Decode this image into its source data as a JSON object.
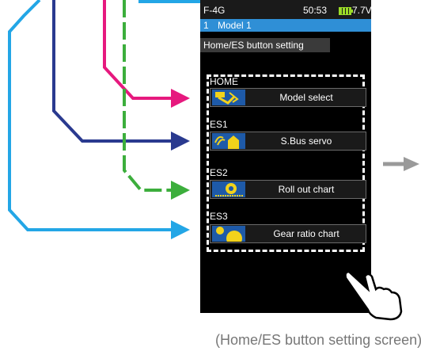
{
  "status_bar": {
    "model": "F-4G",
    "timer": "50:53",
    "voltage": "7.7V"
  },
  "model_row": {
    "number": "1",
    "name": "Model 1"
  },
  "screen_title": "Home/ES button setting",
  "buttons": [
    {
      "key": "HOME",
      "label": "Model select",
      "icon": "model-select-icon"
    },
    {
      "key": "ES1",
      "label": "S.Bus servo",
      "icon": "sbus-servo-icon"
    },
    {
      "key": "ES2",
      "label": "Roll out chart",
      "icon": "roll-out-chart-icon"
    },
    {
      "key": "ES3",
      "label": "Gear ratio chart",
      "icon": "gear-ratio-chart-icon"
    }
  ],
  "caption": "(Home/ES button setting screen)",
  "colors": {
    "arrow_cyan": "#23a6e6",
    "arrow_blue": "#2a3a8f",
    "arrow_magenta": "#e6197e",
    "arrow_green": "#3cae3c",
    "arrow_gray": "#9a9a9a",
    "title_blue": "#2f8fd6",
    "icon_blue": "#1e5aa8",
    "icon_yellow": "#f2d21b"
  }
}
